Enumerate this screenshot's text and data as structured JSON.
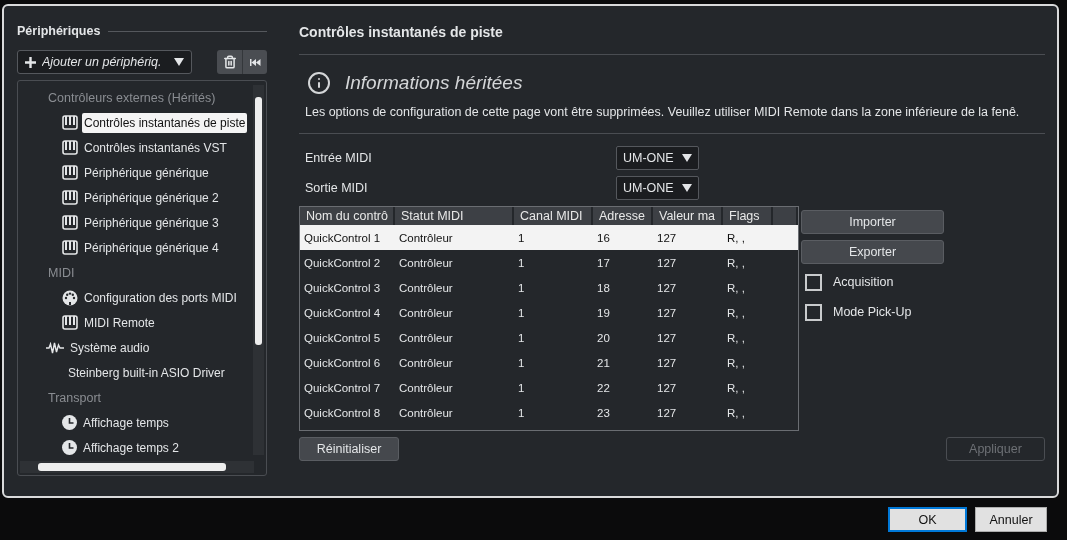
{
  "sidebar": {
    "title": "Périphériques",
    "add_device": {
      "placeholder": "Ajouter un périphériq."
    },
    "tree": [
      {
        "kind": "category",
        "label": "Contrôleurs externes (Hérités)",
        "children": [
          {
            "kind": "keyboard",
            "label": "Contrôles instantanés de piste",
            "selected": true
          },
          {
            "kind": "keyboard",
            "label": "Contrôles instantanés VST",
            "selected": false
          },
          {
            "kind": "keyboard",
            "label": "Périphérique générique",
            "selected": false
          },
          {
            "kind": "keyboard",
            "label": "Périphérique générique 2",
            "selected": false
          },
          {
            "kind": "keyboard",
            "label": "Périphérique générique 3",
            "selected": false
          },
          {
            "kind": "keyboard",
            "label": "Périphérique générique 4",
            "selected": false
          }
        ]
      },
      {
        "kind": "category",
        "label": "MIDI",
        "children": [
          {
            "kind": "midi-port",
            "label": "Configuration des ports MIDI",
            "selected": false
          },
          {
            "kind": "keyboard",
            "label": "MIDI Remote",
            "selected": false
          }
        ]
      },
      {
        "kind": "audio",
        "label": "Système audio",
        "selected": false,
        "children": [
          {
            "kind": "plain",
            "label": "Steinberg built-in ASIO Driver",
            "selected": false
          }
        ]
      },
      {
        "kind": "category",
        "label": "Transport",
        "children": [
          {
            "kind": "clock",
            "label": "Affichage temps",
            "selected": false
          },
          {
            "kind": "clock",
            "label": "Affichage temps 2",
            "selected": false
          }
        ]
      }
    ]
  },
  "panel": {
    "title": "Contrôles instantanés de piste",
    "notice": {
      "title": "Informations héritées",
      "message": "Les options de configuration de cette page vont être supprimées. Veuillez utiliser MIDI Remote dans la zone inférieure de la fenê."
    },
    "ports": [
      {
        "label": "Entrée MIDI",
        "value": "UM-ONE"
      },
      {
        "label": "Sortie MIDI",
        "value": "UM-ONE"
      }
    ],
    "table": {
      "columns": [
        "Nom du contrô",
        "Statut MIDI",
        "Canal MIDI",
        "Adresse",
        "Valeur ma",
        "Flags"
      ],
      "rows": [
        {
          "cells": [
            "QuickControl 1",
            "Contrôleur",
            "1",
            "16",
            "127",
            "R, ,"
          ],
          "selected": true
        },
        {
          "cells": [
            "QuickControl 2",
            "Contrôleur",
            "1",
            "17",
            "127",
            "R, ,"
          ],
          "selected": false
        },
        {
          "cells": [
            "QuickControl 3",
            "Contrôleur",
            "1",
            "18",
            "127",
            "R, ,"
          ],
          "selected": false
        },
        {
          "cells": [
            "QuickControl 4",
            "Contrôleur",
            "1",
            "19",
            "127",
            "R, ,"
          ],
          "selected": false
        },
        {
          "cells": [
            "QuickControl 5",
            "Contrôleur",
            "1",
            "20",
            "127",
            "R, ,"
          ],
          "selected": false
        },
        {
          "cells": [
            "QuickControl 6",
            "Contrôleur",
            "1",
            "21",
            "127",
            "R, ,"
          ],
          "selected": false
        },
        {
          "cells": [
            "QuickControl 7",
            "Contrôleur",
            "1",
            "22",
            "127",
            "R, ,"
          ],
          "selected": false
        },
        {
          "cells": [
            "QuickControl 8",
            "Contrôleur",
            "1",
            "23",
            "127",
            "R, ,"
          ],
          "selected": false
        }
      ]
    },
    "side_buttons": [
      "Importer",
      "Exporter"
    ],
    "options": [
      {
        "label": "Acquisition",
        "checked": false
      },
      {
        "label": "Mode Pick-Up",
        "checked": false
      }
    ],
    "reset_button": "Réinitialiser",
    "apply_button": {
      "label": "Appliquer",
      "disabled": true
    }
  },
  "footer": {
    "buttons": [
      {
        "label": "OK",
        "default": true
      },
      {
        "label": "Annuler",
        "default": false
      }
    ]
  }
}
